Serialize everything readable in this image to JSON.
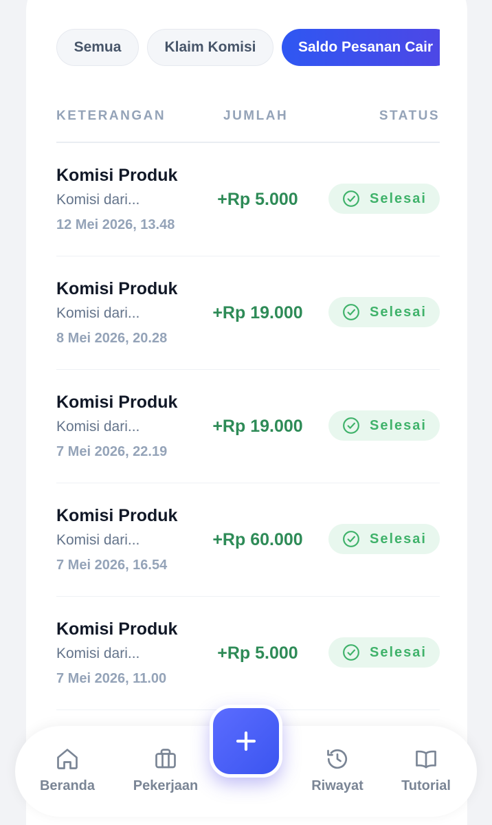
{
  "tabs": [
    {
      "label": "Semua",
      "active": false
    },
    {
      "label": "Klaim Komisi",
      "active": false
    },
    {
      "label": "Saldo Pesanan Cair",
      "active": true
    }
  ],
  "table": {
    "headers": {
      "keterangan": "KETERANGAN",
      "jumlah": "JUMLAH",
      "status": "STATUS"
    },
    "rows": [
      {
        "title": "Komisi Produk",
        "desc": "Komisi dari...",
        "date": "12 Mei 2026, 13.48",
        "amount": "+Rp 5.000",
        "status": "Selesai"
      },
      {
        "title": "Komisi Produk",
        "desc": "Komisi dari...",
        "date": "8 Mei 2026, 20.28",
        "amount": "+Rp 19.000",
        "status": "Selesai"
      },
      {
        "title": "Komisi Produk",
        "desc": "Komisi dari...",
        "date": "7 Mei 2026, 22.19",
        "amount": "+Rp 19.000",
        "status": "Selesai"
      },
      {
        "title": "Komisi Produk",
        "desc": "Komisi dari...",
        "date": "7 Mei 2026, 16.54",
        "amount": "+Rp 60.000",
        "status": "Selesai"
      },
      {
        "title": "Komisi Produk",
        "desc": "Komisi dari...",
        "date": "7 Mei 2026, 11.00",
        "amount": "+Rp 5.000",
        "status": "Selesai"
      }
    ]
  },
  "nav": {
    "items": [
      {
        "label": "Beranda",
        "icon": "home-icon"
      },
      {
        "label": "Pekerjaan",
        "icon": "briefcase-icon"
      },
      {
        "label": "Riwayat",
        "icon": "history-icon"
      },
      {
        "label": "Tutorial",
        "icon": "book-icon"
      }
    ],
    "fab_icon": "plus-icon"
  },
  "colors": {
    "accent": "#3b55f0",
    "success_text": "#3fb26a",
    "success_bg": "#e8f7ee",
    "amount": "#2e8b57"
  }
}
